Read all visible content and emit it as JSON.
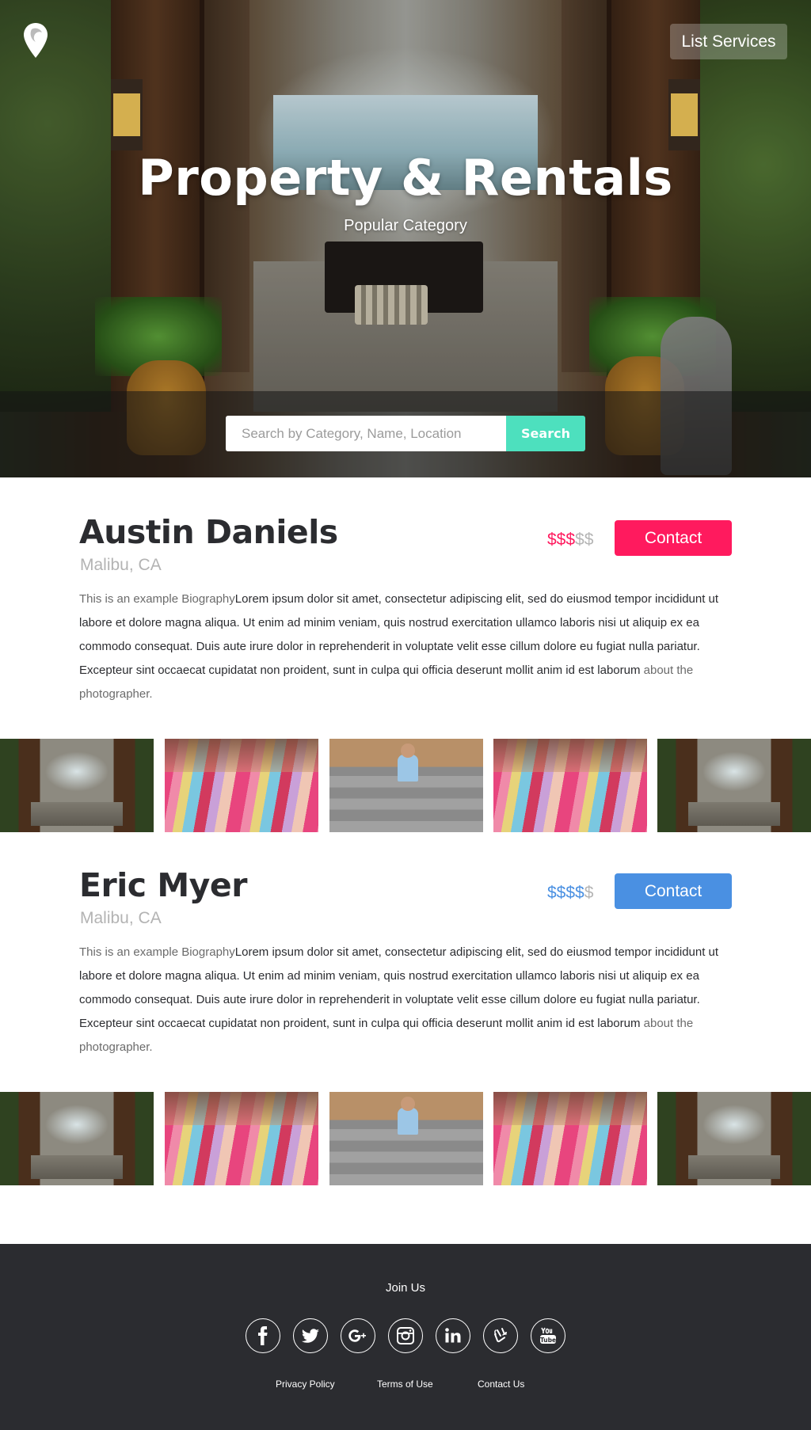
{
  "header": {
    "logo_icon": "map-pin-icon",
    "list_services_label": "List Services",
    "title": "Property & Rentals",
    "subtitle": "Popular Category"
  },
  "search": {
    "placeholder": "Search by Category, Name, Location",
    "button_label": "Search",
    "button_color": "#4de0be"
  },
  "listings": [
    {
      "name": "Austin Daniels",
      "location": "Malibu, CA",
      "price_active": "$$$",
      "price_inactive": "$$",
      "price_level": 3,
      "price_max": 5,
      "accent_color": "#ff1a5e",
      "contact_label": "Contact",
      "bio_intro": "This is an example Biography",
      "bio_body": "Lorem ipsum dolor sit amet, consectetur adipiscing elit, sed do eiusmod tempor incididunt ut labore et dolore magna aliqua. Ut enim ad minim veniam, quis nostrud exercitation ullamco laboris nisi ut aliquip ex ea commodo consequat. Duis aute irure dolor in reprehenderit in voluptate velit esse cillum dolore eu fugiat nulla pariatur. Excepteur sint occaecat cupidatat non proident, sunt in culpa qui officia deserunt mollit anim id est laborum",
      "bio_link": " about the photographer."
    },
    {
      "name": "Eric Myer",
      "location": "Malibu, CA",
      "price_active": "$$$$",
      "price_inactive": "$",
      "price_level": 4,
      "price_max": 5,
      "accent_color": "#4a90e2",
      "contact_label": "Contact",
      "bio_intro": "This is an example Biography",
      "bio_body": "Lorem ipsum dolor sit amet, consectetur adipiscing elit, sed do eiusmod tempor incididunt ut labore et dolore magna aliqua. Ut enim ad minim veniam, quis nostrud exercitation ullamco laboris nisi ut aliquip ex ea commodo consequat. Duis aute irure dolor in reprehenderit in voluptate velit esse cillum dolore eu fugiat nulla pariatur. Excepteur sint occaecat cupidatat non proident, sunt in culpa qui officia deserunt mollit anim id est laborum",
      "bio_link": " about the photographer."
    }
  ],
  "footer": {
    "join_label": "Join Us",
    "social_icons": [
      "facebook-icon",
      "twitter-icon",
      "google-plus-icon",
      "instagram-icon",
      "linkedin-icon",
      "vine-icon",
      "youtube-icon"
    ],
    "links": [
      "Privacy Policy",
      "Terms of Use",
      "Contact Us"
    ]
  }
}
